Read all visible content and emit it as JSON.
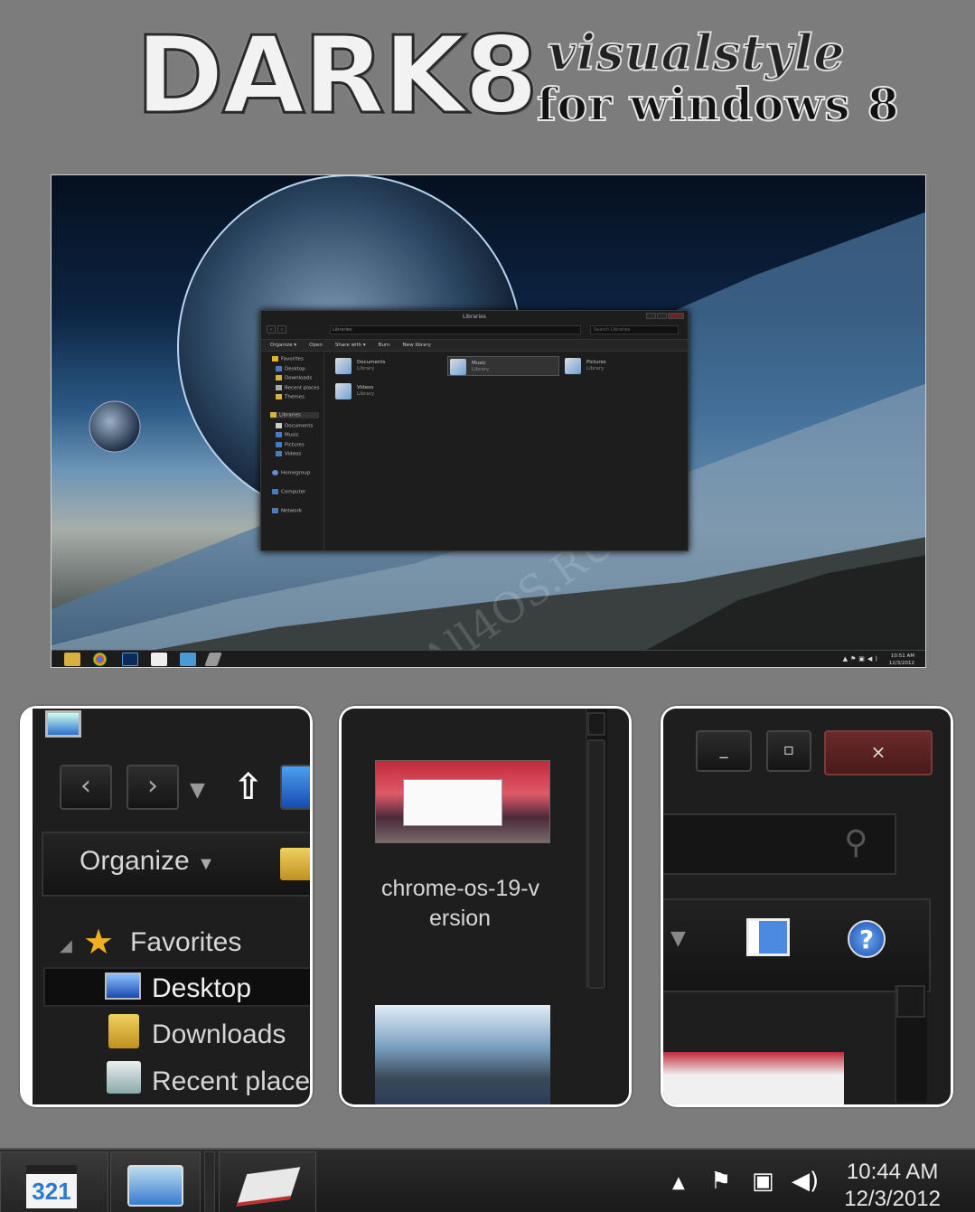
{
  "header": {
    "title": "DARK8",
    "subtitle_line1": "visualstyle",
    "subtitle_line2": "for windows 8"
  },
  "screenshot": {
    "watermark": "All4OS.RU",
    "explorer": {
      "window_title": "Libraries",
      "address": "Libraries",
      "search_placeholder": "Search Libraries",
      "commands": [
        "Organize ▾",
        "Open",
        "Share with ▾",
        "Burn",
        "New library"
      ],
      "nav": [
        {
          "label": "Favorites",
          "icon": "star-icon"
        },
        {
          "label": "Desktop",
          "icon": "desktop-icon"
        },
        {
          "label": "Downloads",
          "icon": "downloads-icon"
        },
        {
          "label": "Recent places",
          "icon": "recent-places-icon"
        },
        {
          "label": "Themes",
          "icon": "folder-icon"
        },
        {
          "label": "Libraries",
          "icon": "libraries-icon"
        },
        {
          "label": "Documents",
          "icon": "documents-icon"
        },
        {
          "label": "Music",
          "icon": "music-icon"
        },
        {
          "label": "Pictures",
          "icon": "pictures-icon"
        },
        {
          "label": "Videos",
          "icon": "videos-icon"
        },
        {
          "label": "Homegroup",
          "icon": "homegroup-icon"
        },
        {
          "label": "Computer",
          "icon": "computer-icon"
        },
        {
          "label": "Network",
          "icon": "network-icon"
        }
      ],
      "libraries": [
        {
          "name": "Documents",
          "type": "Library"
        },
        {
          "name": "Music",
          "type": "Library"
        },
        {
          "name": "Pictures",
          "type": "Library"
        },
        {
          "name": "Videos",
          "type": "Library"
        }
      ]
    },
    "taskbar": {
      "time": "10:51 AM",
      "date": "12/3/2012"
    }
  },
  "panel1": {
    "organize": "Organize",
    "favorites": "Favorites",
    "desktop": "Desktop",
    "downloads": "Downloads",
    "recent": "Recent place"
  },
  "panel2": {
    "file_name_line1": "chrome-os-19-v",
    "file_name_line2": "ersion"
  },
  "panel3": {
    "minimize": "_",
    "maximize": "▫",
    "close": "×",
    "help": "?"
  },
  "taskbar": {
    "time": "10:44 AM",
    "date": "12/3/2012"
  }
}
